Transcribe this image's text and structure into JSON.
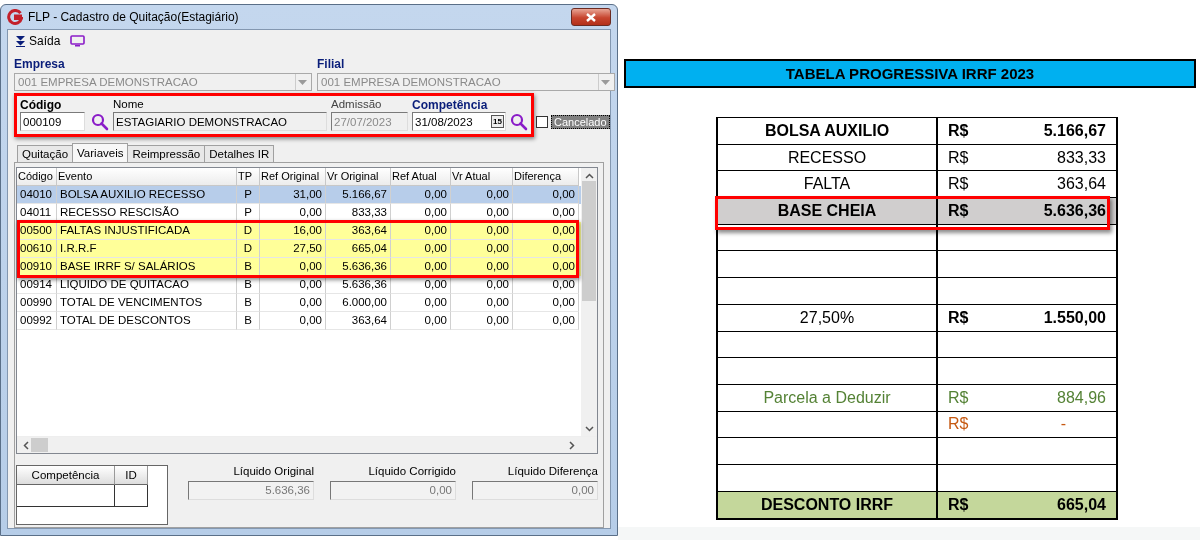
{
  "window": {
    "title": "FLP - Cadastro de Quitação(Estagiário)"
  },
  "toolbar": {
    "exit_label": "Saída"
  },
  "company": {
    "label": "Empresa",
    "value": "001 EMPRESA DEMONSTRACAO",
    "disabled": true
  },
  "branch": {
    "label": "Filial",
    "value": "001 EMPRESA DEMONSTRACAO",
    "disabled": true
  },
  "employee": {
    "marked": true,
    "code": {
      "label": "Código",
      "value": "000109"
    },
    "name": {
      "label": "Nome",
      "value": "ESTAGIARIO DEMONSTRACAO"
    },
    "admission": {
      "label": "Admissão",
      "value": "27/07/2023",
      "disabled": true
    },
    "period": {
      "label": "Competência",
      "value": "31/08/2023",
      "calendar": "15"
    }
  },
  "cancelled": {
    "label": "Cancelado",
    "checked": false
  },
  "tabs": [
    {
      "label": "Quitação",
      "selected": false
    },
    {
      "label": "Variaveis",
      "selected": true
    },
    {
      "label": "Reimpressão",
      "selected": false
    },
    {
      "label": "Detalhes IR",
      "selected": false
    }
  ],
  "grid": {
    "columns": [
      "Código",
      "Evento",
      "TP",
      "Ref Original",
      "Vr Original",
      "Ref Atual",
      "Vr Atual",
      "Diferença"
    ],
    "rows": [
      {
        "cells": [
          "04010",
          "BOLSA AUXILIO RECESSO",
          "P",
          "31,00",
          "5.166,67",
          "0,00",
          "0,00",
          "0,00"
        ],
        "selected": true,
        "highlighted": false
      },
      {
        "cells": [
          "04011",
          "RECESSO RESCISÃO",
          "P",
          "0,00",
          "833,33",
          "0,00",
          "0,00",
          "0,00"
        ],
        "selected": false,
        "highlighted": false
      },
      {
        "cells": [
          "00500",
          "FALTAS INJUSTIFICADA",
          "D",
          "16,00",
          "363,64",
          "0,00",
          "0,00",
          "0,00"
        ],
        "selected": false,
        "highlighted": true
      },
      {
        "cells": [
          "00610",
          "I.R.R.F",
          "D",
          "27,50",
          "665,04",
          "0,00",
          "0,00",
          "0,00"
        ],
        "selected": false,
        "highlighted": true
      },
      {
        "cells": [
          "00910",
          "BASE IRRF S/ SALÁRIOS",
          "B",
          "0,00",
          "5.636,36",
          "0,00",
          "0,00",
          "0,00"
        ],
        "selected": false,
        "highlighted": true
      },
      {
        "cells": [
          "00914",
          "LIQUIDO DE QUITACAO",
          "B",
          "0,00",
          "5.636,36",
          "0,00",
          "0,00",
          "0,00"
        ],
        "selected": false,
        "highlighted": false
      },
      {
        "cells": [
          "00990",
          "TOTAL DE VENCIMENTOS",
          "B",
          "0,00",
          "6.000,00",
          "0,00",
          "0,00",
          "0,00"
        ],
        "selected": false,
        "highlighted": false
      },
      {
        "cells": [
          "00992",
          "TOTAL DE DESCONTOS",
          "B",
          "0,00",
          "363,64",
          "0,00",
          "0,00",
          "0,00"
        ],
        "selected": false,
        "highlighted": false
      }
    ]
  },
  "history": {
    "columns": [
      "Competência",
      "ID"
    ]
  },
  "totals": [
    {
      "label": "Líquido Original",
      "value": "5.636,36"
    },
    {
      "label": "Líquido Corrigido",
      "value": "0,00"
    },
    {
      "label": "Líquido Diferença",
      "value": "0,00"
    }
  ],
  "sheet": {
    "title": "TABELA PROGRESSIVA IRRF 2023",
    "rows": [
      {
        "kind": "bold",
        "label": "BOLSA AUXILIO",
        "currency": "R$",
        "value": "5.166,67",
        "marked": false
      },
      {
        "kind": "normal",
        "label": "RECESSO",
        "currency": "R$",
        "value": "833,33",
        "marked": false
      },
      {
        "kind": "normal",
        "label": "FALTA",
        "currency": "R$",
        "value": "363,64",
        "marked": false
      },
      {
        "kind": "shaded",
        "label": "BASE CHEIA",
        "currency": "R$",
        "value": "5.636,36",
        "marked": true
      },
      {
        "kind": "empty",
        "marked": false
      },
      {
        "kind": "empty",
        "marked": false
      },
      {
        "kind": "empty",
        "marked": false
      },
      {
        "kind": "rate",
        "label": "27,50%",
        "currency": "R$",
        "value": "1.550,00",
        "marked": false
      },
      {
        "kind": "empty",
        "marked": false
      },
      {
        "kind": "empty",
        "marked": false
      },
      {
        "kind": "green",
        "label": "Parcela a Deduzir",
        "currency": "R$",
        "value": "884,96",
        "marked": false
      },
      {
        "kind": "orange",
        "currency": "R$",
        "value": "-",
        "marked": false
      },
      {
        "kind": "empty",
        "marked": false
      },
      {
        "kind": "empty",
        "marked": false
      },
      {
        "kind": "total",
        "label": "DESCONTO IRRF",
        "currency": "R$",
        "value": "665,04",
        "marked": false
      }
    ]
  }
}
